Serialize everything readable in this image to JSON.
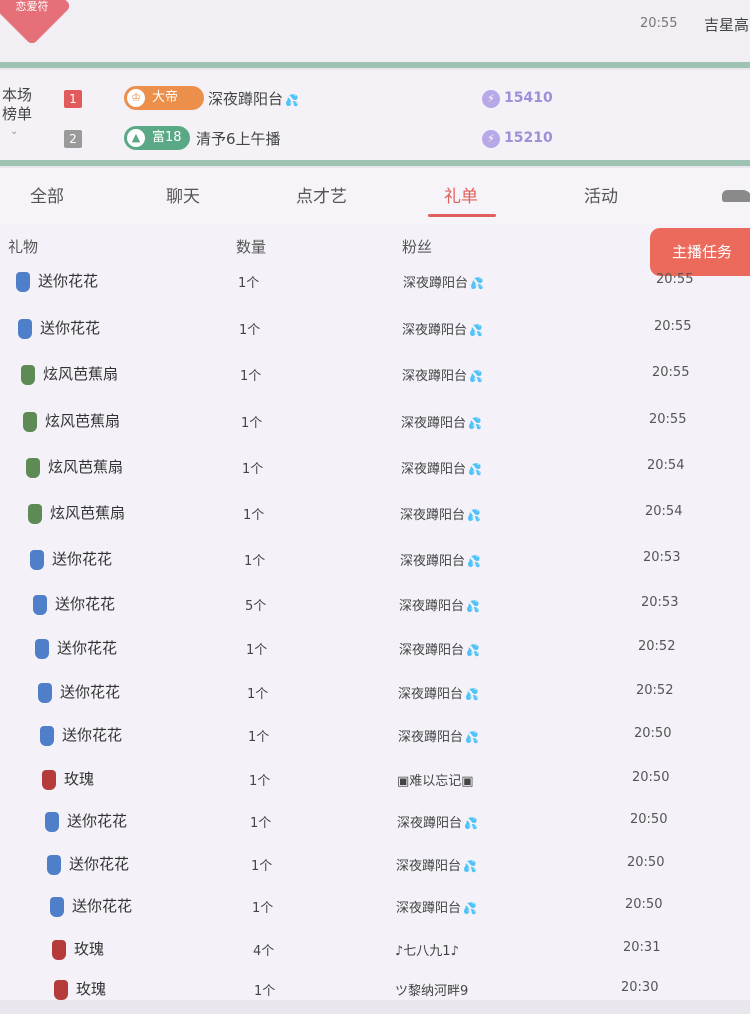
{
  "top": {
    "badge": "恋爱符",
    "time": "20:55",
    "user": "吉星高"
  },
  "rank": {
    "title": "本场榜单",
    "chevron": "⌄",
    "rows": [
      {
        "num": "1",
        "num_color": "#e25a5a",
        "badge_label": "大帝",
        "badge_icon": "♔",
        "badge_color": "#ec8f4a",
        "name": "深夜蹲阳台",
        "score": "15410"
      },
      {
        "num": "2",
        "num_color": "#9a9a9a",
        "badge_label": "富18",
        "badge_icon": "▲",
        "badge_color": "#5aa886",
        "name": "清予6上午播",
        "score": "15210"
      }
    ]
  },
  "tabs": [
    "全部",
    "聊天",
    "点才艺",
    "礼单",
    "活动"
  ],
  "active_tab": "礼单",
  "table": {
    "headers": {
      "gift": "礼物",
      "qty": "数量",
      "fan": "粉丝"
    },
    "task_button": "主播任务",
    "rows": [
      {
        "gift": "送你花花",
        "qty": "1个",
        "fan": "深夜蹲阳台",
        "time": "20:55",
        "icon": "flower"
      },
      {
        "gift": "送你花花",
        "qty": "1个",
        "fan": "深夜蹲阳台",
        "time": "20:55",
        "icon": "flower"
      },
      {
        "gift": "炫风芭蕉扇",
        "qty": "1个",
        "fan": "深夜蹲阳台",
        "time": "20:55",
        "icon": "fan"
      },
      {
        "gift": "炫风芭蕉扇",
        "qty": "1个",
        "fan": "深夜蹲阳台",
        "time": "20:55",
        "icon": "fan"
      },
      {
        "gift": "炫风芭蕉扇",
        "qty": "1个",
        "fan": "深夜蹲阳台",
        "time": "20:54",
        "icon": "fan"
      },
      {
        "gift": "炫风芭蕉扇",
        "qty": "1个",
        "fan": "深夜蹲阳台",
        "time": "20:54",
        "icon": "fan"
      },
      {
        "gift": "送你花花",
        "qty": "1个",
        "fan": "深夜蹲阳台",
        "time": "20:53",
        "icon": "flower"
      },
      {
        "gift": "送你花花",
        "qty": "5个",
        "fan": "深夜蹲阳台",
        "time": "20:53",
        "icon": "flower"
      },
      {
        "gift": "送你花花",
        "qty": "1个",
        "fan": "深夜蹲阳台",
        "time": "20:52",
        "icon": "flower"
      },
      {
        "gift": "送你花花",
        "qty": "1个",
        "fan": "深夜蹲阳台",
        "time": "20:52",
        "icon": "flower"
      },
      {
        "gift": "送你花花",
        "qty": "1个",
        "fan": "深夜蹲阳台",
        "time": "20:50",
        "icon": "flower"
      },
      {
        "gift": "玫瑰",
        "qty": "1个",
        "fan": "▣难以忘记▣",
        "time": "20:50",
        "icon": "rose"
      },
      {
        "gift": "送你花花",
        "qty": "1个",
        "fan": "深夜蹲阳台",
        "time": "20:50",
        "icon": "flower"
      },
      {
        "gift": "送你花花",
        "qty": "1个",
        "fan": "深夜蹲阳台",
        "time": "20:50",
        "icon": "flower"
      },
      {
        "gift": "送你花花",
        "qty": "1个",
        "fan": "深夜蹲阳台",
        "time": "20:50",
        "icon": "flower"
      },
      {
        "gift": "玫瑰",
        "qty": "4个",
        "fan": "♪七八九1♪",
        "time": "20:31",
        "icon": "rose"
      },
      {
        "gift": "玫瑰",
        "qty": "1个",
        "fan": "ツ黎纳河畔9",
        "time": "20:30",
        "icon": "rose"
      }
    ]
  },
  "colors": {
    "accent": "#e0605c",
    "divider": "#9ec3b3",
    "flower": "#4f7fc8",
    "fan": "#5d8a55",
    "rose": "#b53a3a"
  },
  "drop_glyph": "💦"
}
